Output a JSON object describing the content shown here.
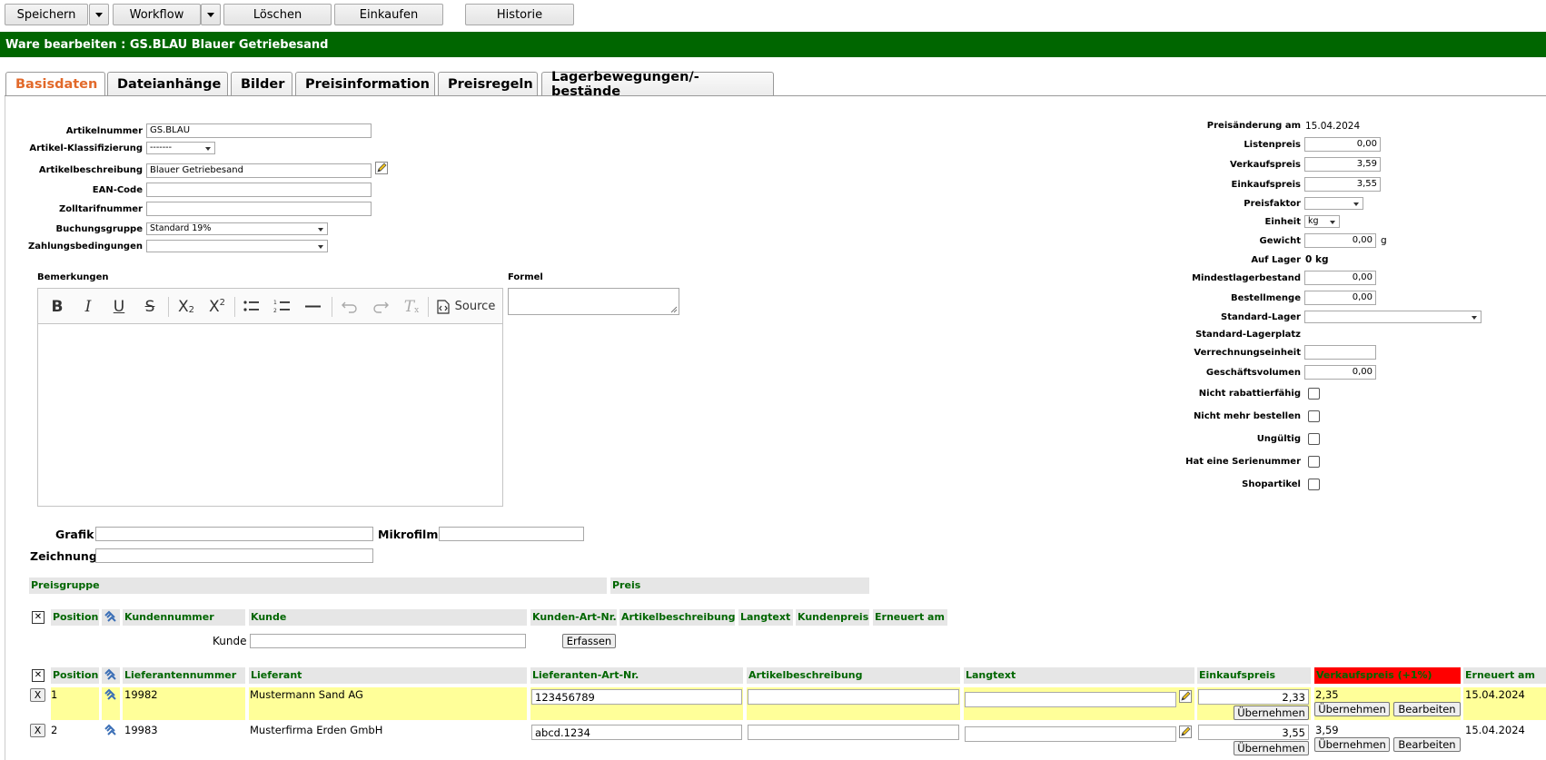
{
  "toolbar": {
    "save": "Speichern",
    "workflow": "Workflow",
    "delete": "Löschen",
    "purchase": "Einkaufen",
    "history": "Historie"
  },
  "title": "Ware bearbeiten : GS.BLAU Blauer Getriebesand",
  "tabs": [
    "Basisdaten",
    "Dateianhänge",
    "Bilder",
    "Preisinformation",
    "Preisregeln",
    "Lagerbewegungen/-bestände"
  ],
  "form_left": {
    "article_number_label": "Artikelnummer",
    "article_number": "GS.BLAU",
    "classification_label": "Artikel-Klassifizierung",
    "classification": "-------",
    "description_label": "Artikelbeschreibung",
    "description": "Blauer Getriebesand",
    "ean_label": "EAN-Code",
    "ean": "",
    "customs_label": "Zolltarifnummer",
    "customs": "",
    "booking_group_label": "Buchungsgruppe",
    "booking_group": "Standard 19%",
    "payment_terms_label": "Zahlungsbedingungen",
    "payment_terms": ""
  },
  "remarks_label": "Bemerkungen",
  "formula_label": "Formel",
  "editor": {
    "source_label": "Source"
  },
  "form_right": {
    "price_change_label": "Preisänderung am",
    "price_change": "15.04.2024",
    "list_price_label": "Listenpreis",
    "list_price": "0,00",
    "sales_price_label": "Verkaufspreis",
    "sales_price": "3,59",
    "purchase_price_label": "Einkaufspreis",
    "purchase_price": "3,55",
    "price_factor_label": "Preisfaktor",
    "price_factor": "",
    "unit_label": "Einheit",
    "unit": "kg",
    "weight_label": "Gewicht",
    "weight": "0,00",
    "weight_unit": "g",
    "in_stock_label": "Auf Lager",
    "in_stock": "0 kg",
    "min_stock_label": "Mindestlagerbestand",
    "min_stock": "0,00",
    "order_qty_label": "Bestellmenge",
    "order_qty": "0,00",
    "default_warehouse_label": "Standard-Lager",
    "default_warehouse": "",
    "default_bin_label": "Standard-Lagerplatz",
    "billing_unit_label": "Verrechnungseinheit",
    "billing_unit": "",
    "business_volume_label": "Geschäftsvolumen",
    "business_volume": "0,00",
    "not_discountable_label": "Nicht rabattierfähig",
    "no_reorder_label": "Nicht mehr bestellen",
    "invalid_label": "Ungültig",
    "has_serial_label": "Hat eine Serienummer",
    "shop_article_label": "Shopartikel"
  },
  "media": {
    "graphic_label": "Grafik",
    "microfilm_label": "Mikrofilm",
    "drawing_label": "Zeichnung"
  },
  "price_groups": {
    "group_header": "Preisgruppe",
    "price_header": "Preis"
  },
  "customers": {
    "headers": [
      "Position",
      "Kundennummer",
      "Kunde",
      "Kunden-Art-Nr.",
      "Artikelbeschreibung",
      "Langtext",
      "Kundenpreis",
      "Erneuert am"
    ],
    "customer_label": "Kunde",
    "customer_input": "",
    "add_button": "Erfassen"
  },
  "suppliers": {
    "headers": [
      "Position",
      "Lieferantennummer",
      "Lieferant",
      "Lieferanten-Art-Nr.",
      "Artikelbeschreibung",
      "Langtext",
      "Einkaufspreis",
      "Verkaufspreis (+1%)",
      "Erneuert am"
    ],
    "highlight_color": "#ff0000",
    "take_over_label": "Übernehmen",
    "edit_label": "Bearbeiten",
    "remove_label": "X",
    "rows": [
      {
        "position": "1",
        "supplier_number": "19982",
        "supplier": "Mustermann Sand AG",
        "supplier_art_no": "123456789",
        "description": "",
        "longtext": "",
        "purchase_price": "2,33",
        "sales_price": "2,35",
        "renewed": "15.04.2024"
      },
      {
        "position": "2",
        "supplier_number": "19983",
        "supplier": "Musterfirma Erden GmbH",
        "supplier_art_no": "abcd.1234",
        "description": "",
        "longtext": "",
        "purchase_price": "3,55",
        "sales_price": "3,59",
        "renewed": "15.04.2024"
      }
    ]
  }
}
